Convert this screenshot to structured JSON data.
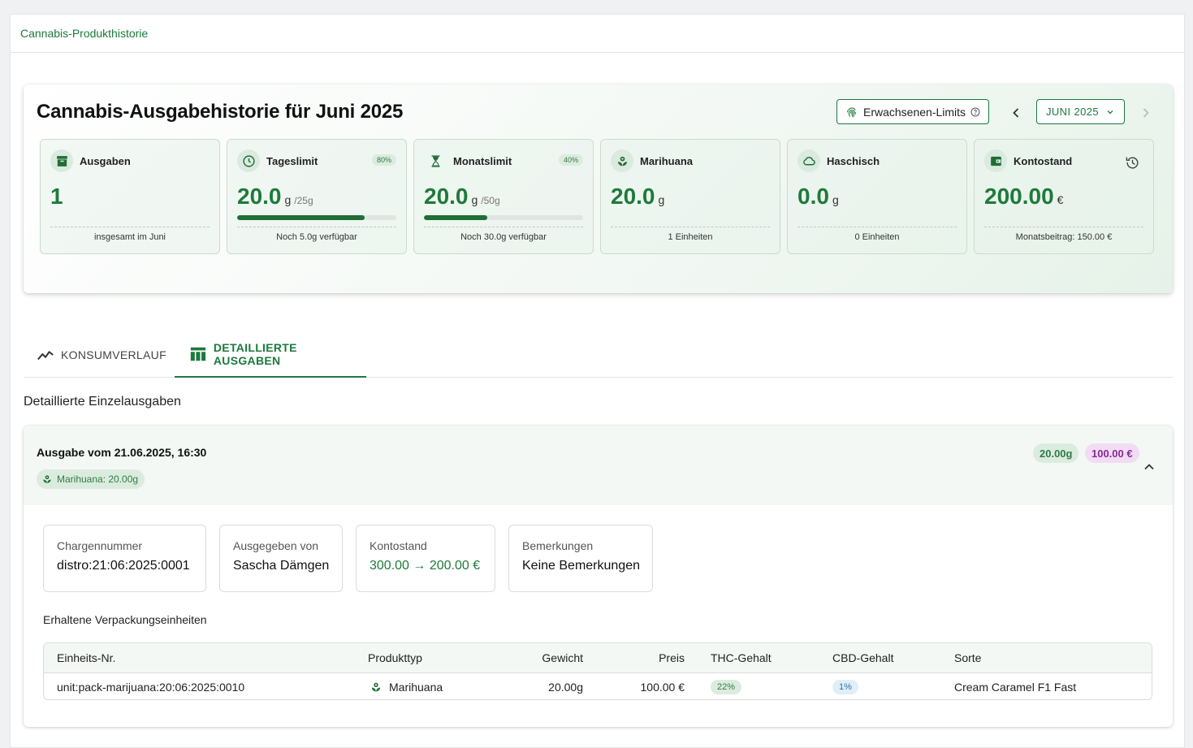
{
  "breadcrumb": "Cannabis-Produkthistorie",
  "summary": {
    "title": "Cannabis-Ausgabehistorie für Juni 2025",
    "limits_button": "Erwachsenen-Limits",
    "month": "JUNI 2025",
    "stats": {
      "ausgaben": {
        "label": "Ausgaben",
        "value": "1",
        "footer": "insgesamt im Juni",
        "icon": "archive-icon"
      },
      "tageslimit": {
        "label": "Tageslimit",
        "badge": "80%",
        "value": "20.0",
        "unit": "g",
        "max": "/25g",
        "progress": 0.8,
        "footer": "Noch 5.0g verfügbar",
        "icon": "clock-icon"
      },
      "monatslimit": {
        "label": "Monatslimit",
        "badge": "40%",
        "value": "20.0",
        "unit": "g",
        "max": "/50g",
        "progress": 0.4,
        "footer": "Noch 30.0g verfügbar",
        "icon": "hourglass-icon"
      },
      "marihuana": {
        "label": "Marihuana",
        "value": "20.0",
        "unit": "g",
        "footer": "1 Einheiten",
        "icon": "plant-icon"
      },
      "haschisch": {
        "label": "Haschisch",
        "value": "0.0",
        "unit": "g",
        "footer": "0 Einheiten",
        "icon": "cloud-icon"
      },
      "kontostand": {
        "label": "Kontostand",
        "value": "200.00",
        "unit": "€",
        "footer": "Monatsbeitrag: 150.00 €",
        "icon": "wallet-icon"
      }
    }
  },
  "tabs": [
    {
      "label": "KONSUMVERLAUF",
      "active": false,
      "icon": "trend-icon"
    },
    {
      "label": "DETAILLIERTE AUSGABEN",
      "active": true,
      "icon": "table-icon"
    }
  ],
  "section_title": "Detaillierte Einzelausgaben",
  "dispense": {
    "title": "Ausgabe vom 21.06.2025, 16:30",
    "chip": "Marihuana: 20.00g",
    "weight_chip": "20.00g",
    "price_chip": "100.00 €",
    "info": {
      "charge": {
        "label": "Chargennummer",
        "value": "distro:21:06:2025:0001"
      },
      "by": {
        "label": "Ausgegeben von",
        "value": "Sascha Dämgen"
      },
      "balance": {
        "label": "Kontostand",
        "value": "300.00 → 200.00 €"
      },
      "notes": {
        "label": "Bemerkungen",
        "value": "Keine Bemerkungen"
      }
    },
    "packages_title": "Erhaltene Verpackungseinheiten",
    "table": {
      "headers": [
        "Einheits-Nr.",
        "Produkttyp",
        "Gewicht",
        "Preis",
        "THC-Gehalt",
        "CBD-Gehalt",
        "Sorte"
      ],
      "rows": [
        [
          "unit:pack-marijuana:20:06:2025:0010",
          "Marihuana",
          "20.00g",
          "100.00 €",
          "22%",
          "1%",
          "Cream Caramel F1 Fast"
        ]
      ]
    }
  },
  "colors": {
    "accent": "#1b7a3d",
    "value_green": "#1f7a3c",
    "price_purple": "#8a2a95"
  }
}
